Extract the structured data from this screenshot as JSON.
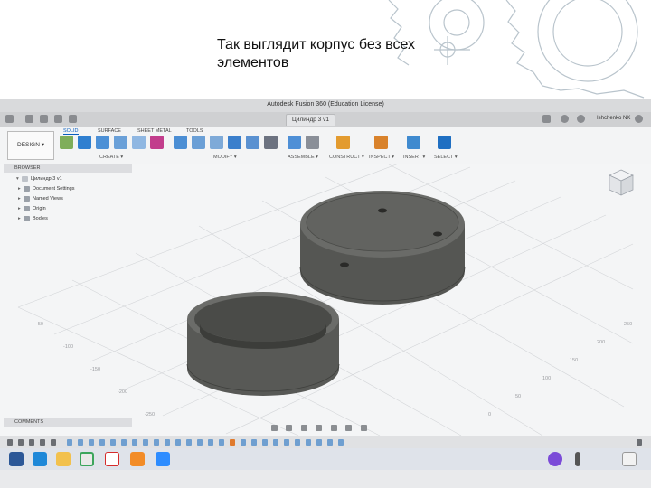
{
  "slide": {
    "caption": "Так выглядит корпус без всех элементов"
  },
  "app": {
    "title": "Autodesk Fusion 360 (Education License)",
    "document_tab": "Цилиндр 3 v1",
    "user": "Ishchenko NK",
    "workspace_button": "DESIGN ▾"
  },
  "ribbon": {
    "tabs": [
      "SOLID",
      "SURFACE",
      "SHEET METAL",
      "TOOLS"
    ],
    "groups": [
      "CREATE ▾",
      "MODIFY ▾",
      "ASSEMBLE ▾",
      "CONSTRUCT ▾",
      "INSPECT ▾",
      "INSERT ▾",
      "SELECT ▾"
    ]
  },
  "browser": {
    "header": "BROWSER",
    "root": "Цилиндр 3 v1",
    "items": [
      "Document Settings",
      "Named Views",
      "Origin",
      "Bodies"
    ]
  },
  "comments": {
    "header": "COMMENTS"
  },
  "axis_ticks": [
    "250",
    "200",
    "150",
    "100",
    "50",
    "0",
    "-50",
    "-100",
    "-150",
    "-200",
    "-250"
  ],
  "colors": {
    "accent": "#0a5fbf",
    "body": "#5a5b58",
    "background": "#e9eaec"
  }
}
